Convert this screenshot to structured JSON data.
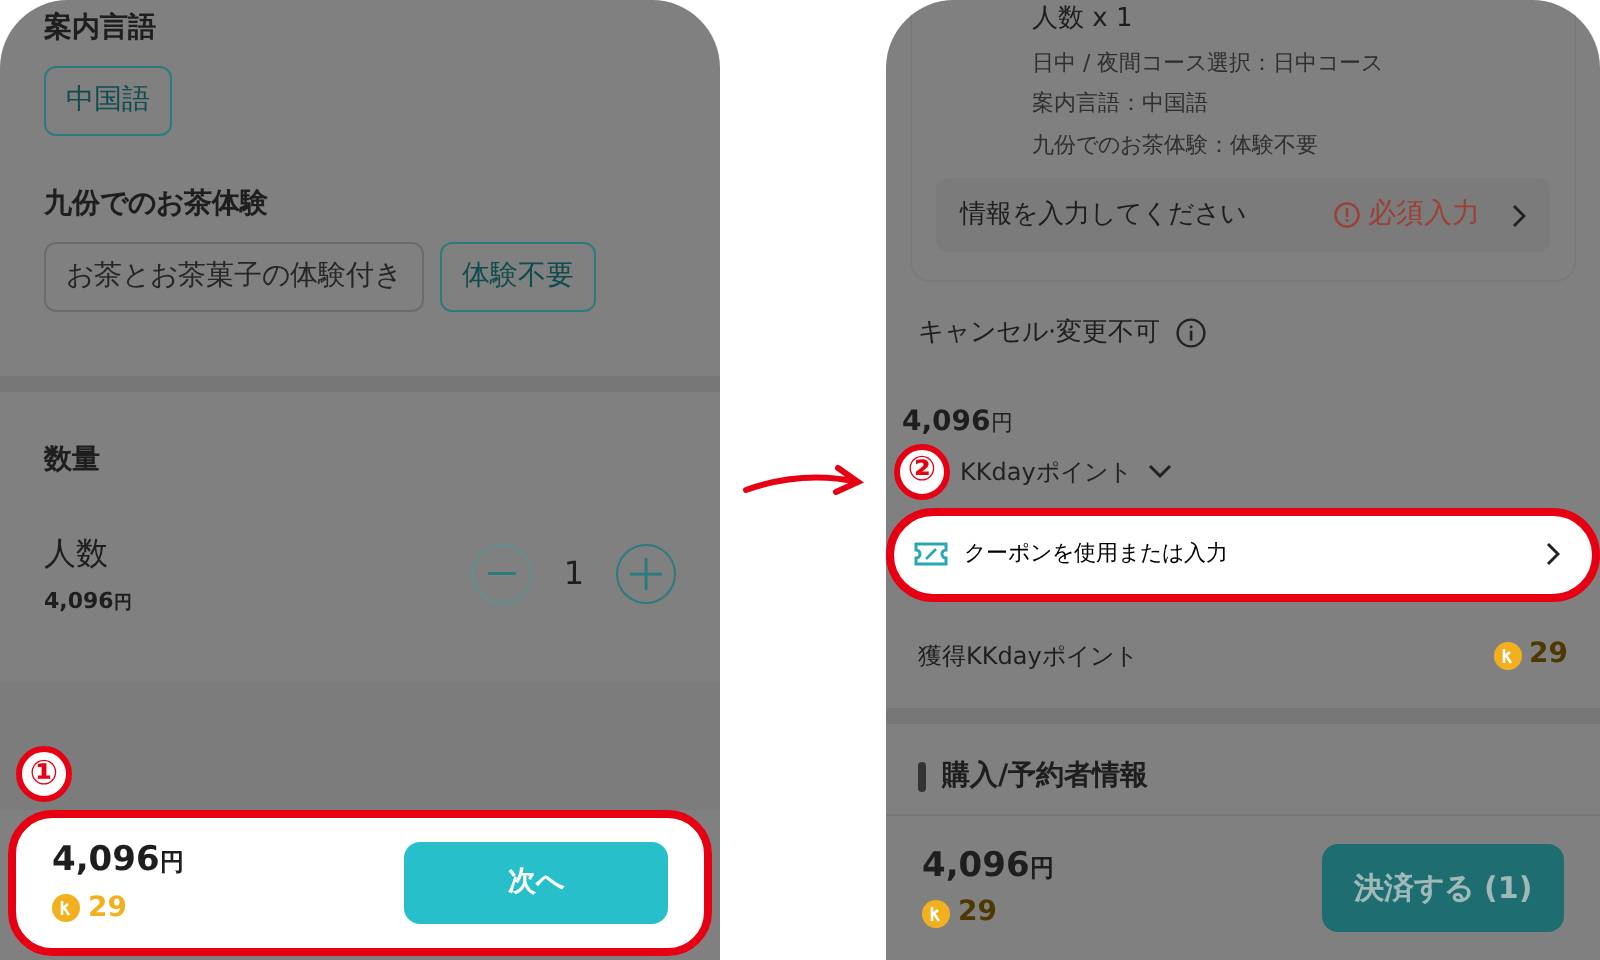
{
  "left_screen": {
    "guide_language": {
      "title": "案内言語",
      "options": [
        {
          "label": "中国語",
          "selected": true
        }
      ]
    },
    "tea_experience": {
      "title": "九份でのお茶体験",
      "options": [
        {
          "label": "お茶とお茶菓子の体験付き",
          "selected": false
        },
        {
          "label": "体験不要",
          "selected": true
        }
      ]
    },
    "quantity": {
      "title": "数量",
      "label": "人数",
      "price": "4,096",
      "currency": "円",
      "stepper": {
        "value": "1",
        "minus_disabled": true
      }
    },
    "step_marker": "①",
    "bottom_bar": {
      "price": "4,096",
      "currency": "円",
      "points": "29",
      "button": "次へ",
      "highlighted": true
    }
  },
  "right_screen": {
    "summary_card": {
      "lines": [
        {
          "text": "人数 x 1",
          "kind": "main"
        },
        {
          "text": "日中 / 夜間コース選択：日中コース",
          "kind": "detail"
        },
        {
          "text": "案内言語：中国語",
          "kind": "detail"
        },
        {
          "text": "九份でのお茶体験：体験不要",
          "kind": "detail"
        }
      ],
      "info_row": {
        "label": "情報を入力してください",
        "status": "必須入力"
      }
    },
    "cancel_policy": "キャンセル·変更不可",
    "price": "4,096",
    "currency": "円",
    "points_toggle": {
      "label": "KKdayポイント",
      "expanded": false
    },
    "step_marker": "②",
    "coupon_row": {
      "label": "クーポンを使用または入力",
      "highlighted": true
    },
    "earned_points": {
      "label": "獲得KKdayポイント",
      "value": "29"
    },
    "section_title": "購入/予約者情報",
    "bottom_bar": {
      "price": "4,096",
      "currency": "円",
      "points": "29",
      "button": "決済する (1)",
      "highlighted": false
    }
  }
}
